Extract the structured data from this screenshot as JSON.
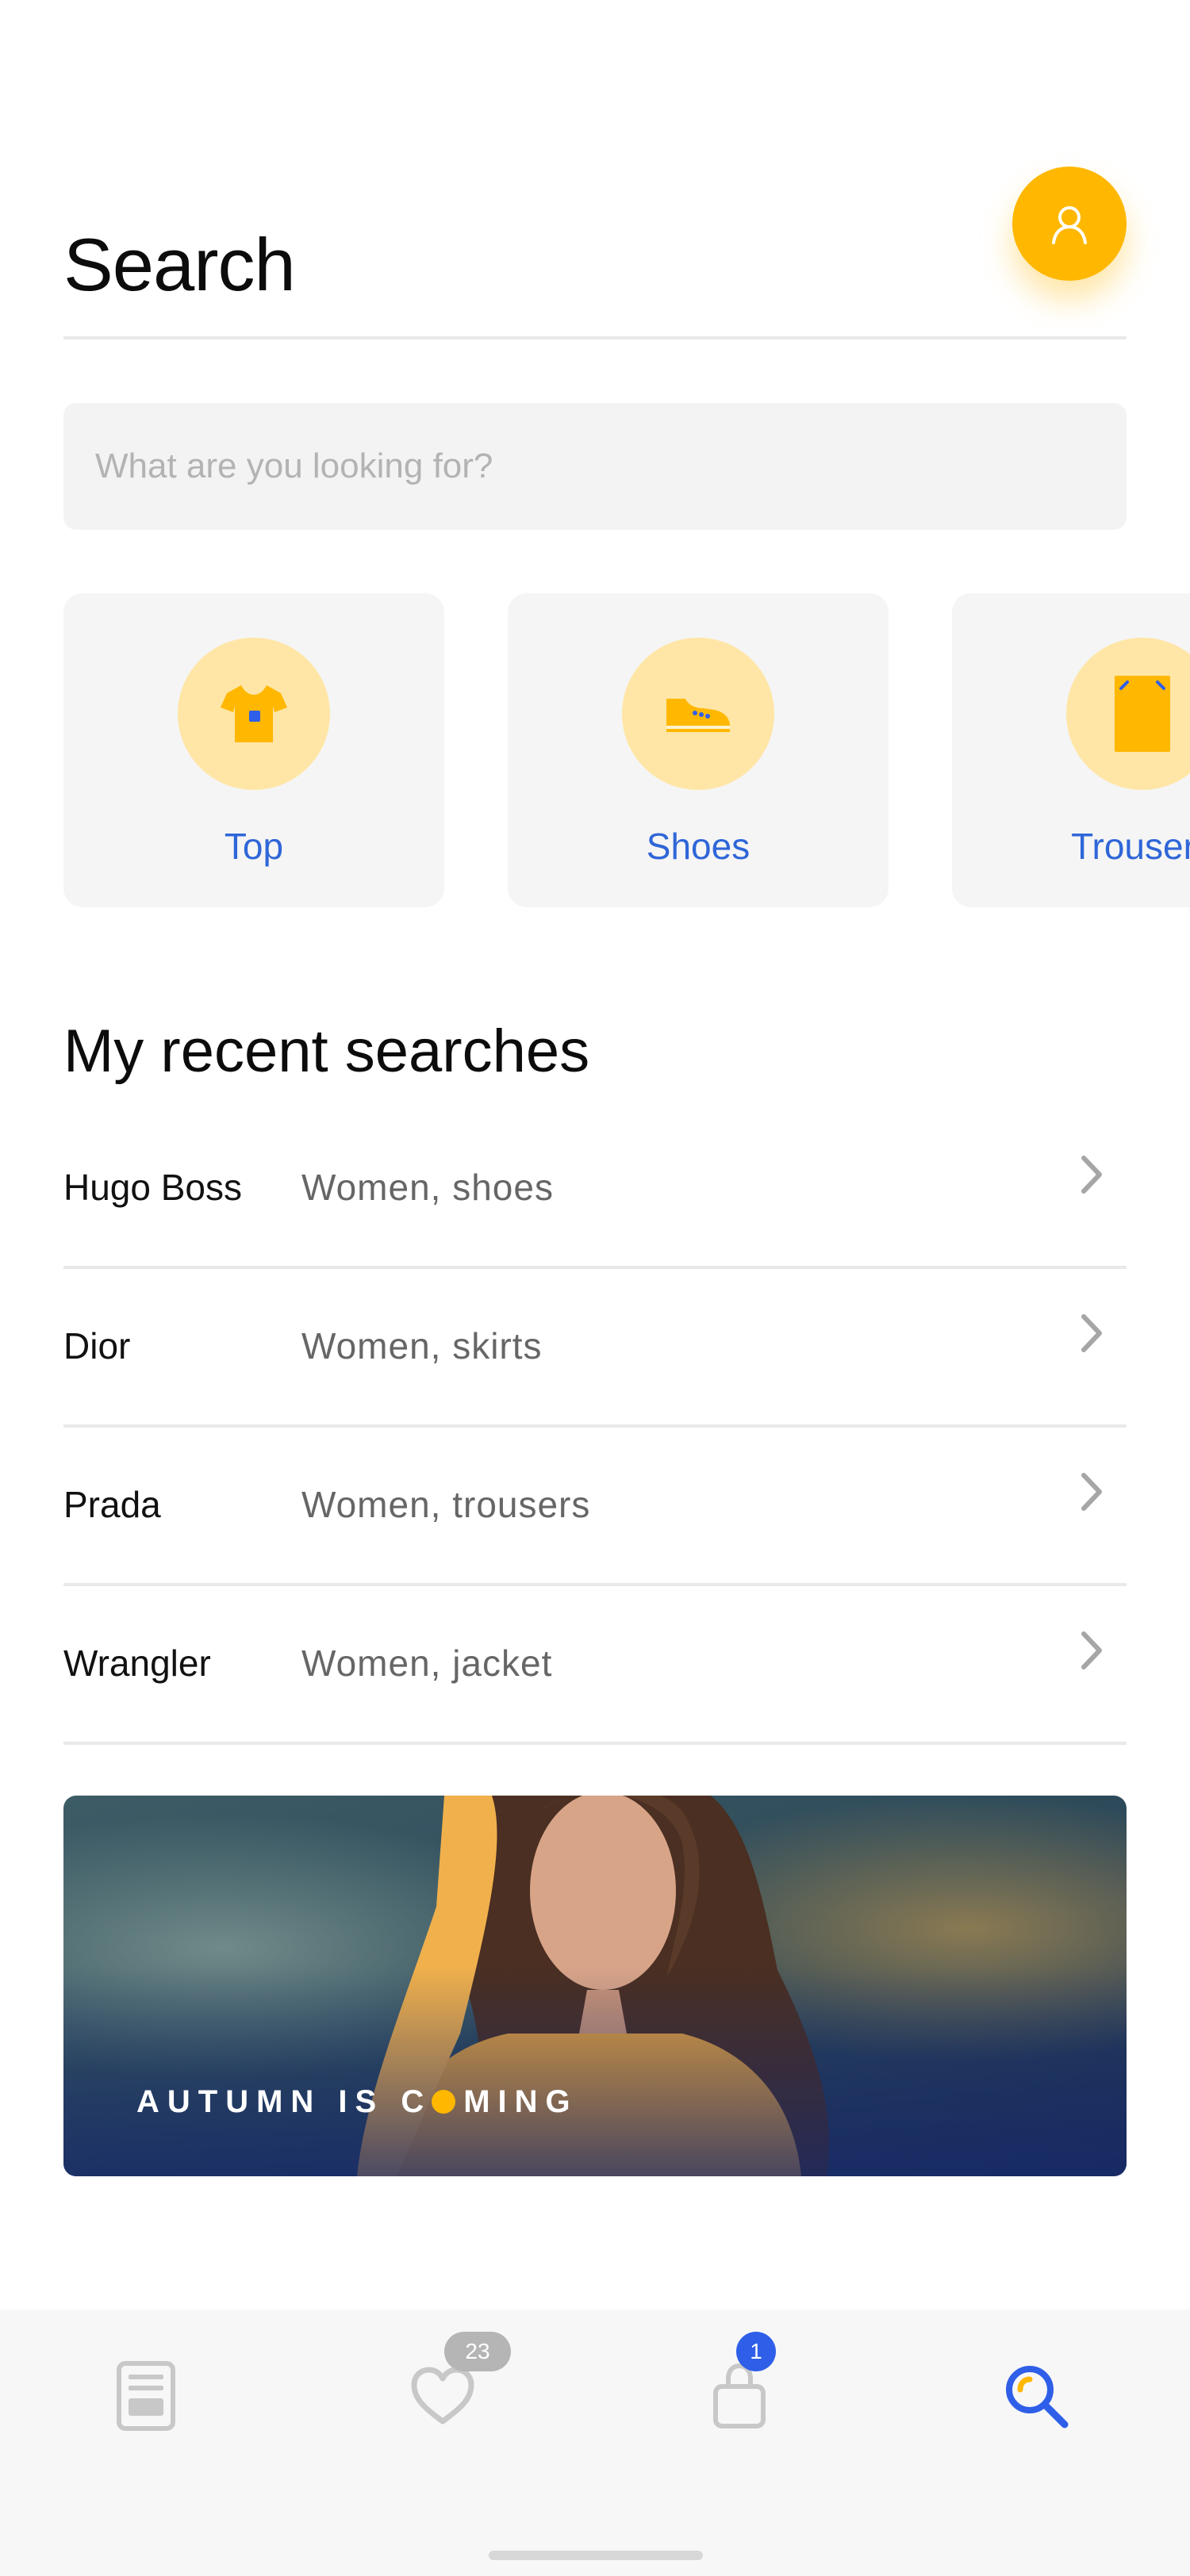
{
  "header": {
    "title": "Search"
  },
  "search": {
    "placeholder": "What are you looking for?"
  },
  "categories": [
    {
      "label": "Top",
      "icon": "tshirt-icon"
    },
    {
      "label": "Shoes",
      "icon": "sneaker-icon"
    },
    {
      "label": "Trousers",
      "icon": "trousers-icon"
    }
  ],
  "recent": {
    "title": "My recent searches",
    "items": [
      {
        "brand": "Hugo Boss",
        "desc": "Women, shoes"
      },
      {
        "brand": "Dior",
        "desc": "Women, skirts"
      },
      {
        "brand": "Prada",
        "desc": "Women, trousers"
      },
      {
        "brand": "Wrangler",
        "desc": "Women, jacket"
      }
    ]
  },
  "banner": {
    "text_before": "AUTUMN IS C",
    "text_after": "MING"
  },
  "tabbar": {
    "tabs": [
      {
        "name": "feed",
        "icon": "document-icon"
      },
      {
        "name": "favorites",
        "icon": "heart-icon",
        "badge": "23"
      },
      {
        "name": "bag",
        "icon": "bag-icon",
        "badge": "1"
      },
      {
        "name": "search",
        "icon": "search-icon",
        "active": true
      }
    ]
  },
  "colors": {
    "accent": "#ffb700",
    "link": "#2f66d8",
    "active_tab": "#2f5fe8"
  }
}
